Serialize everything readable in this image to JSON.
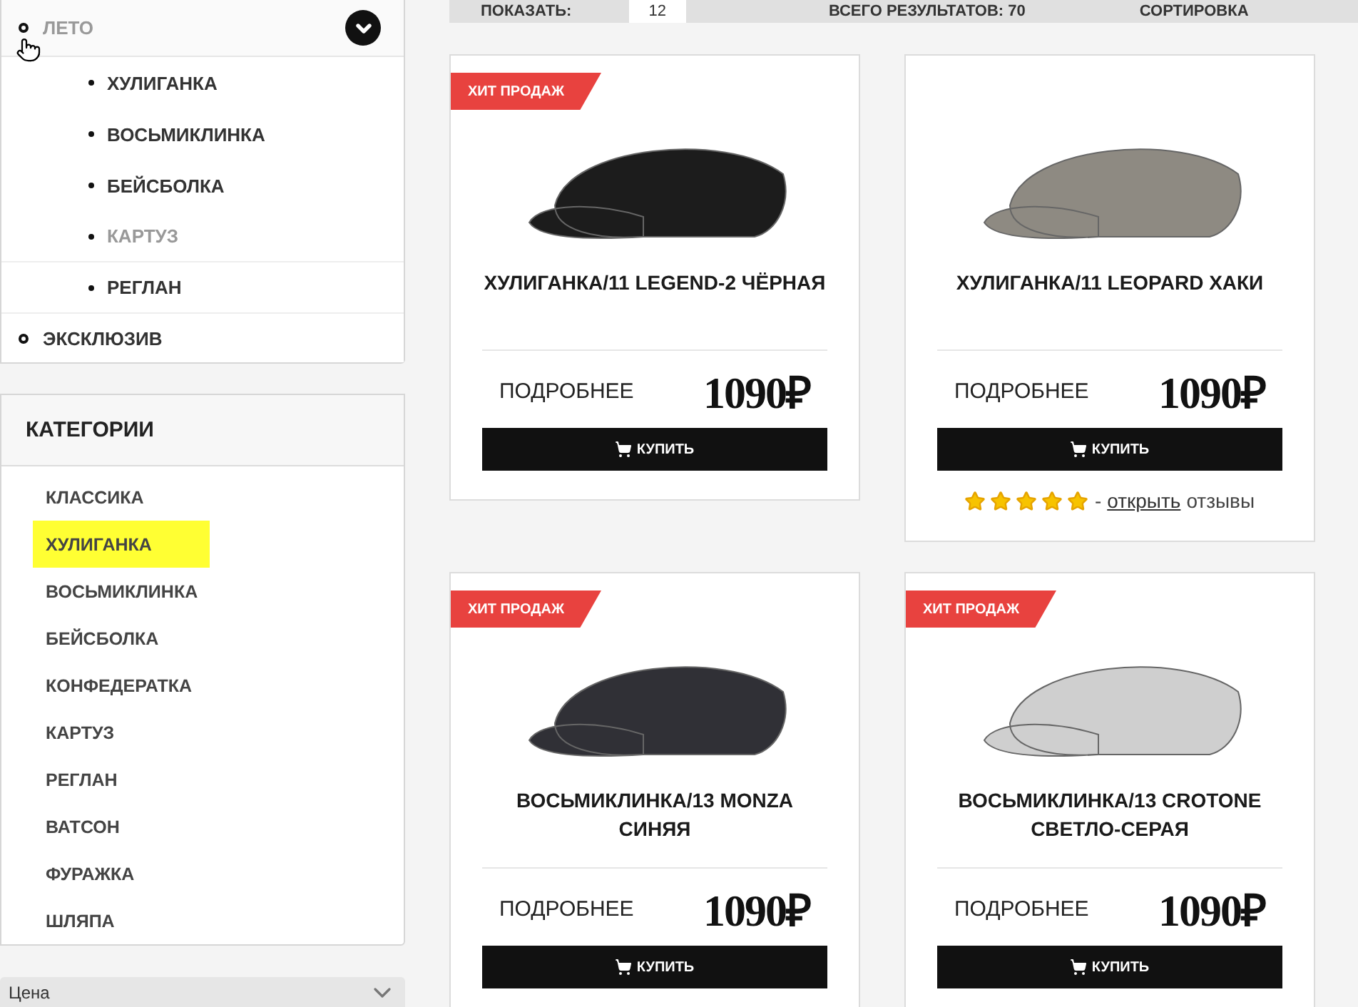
{
  "menu": {
    "items": [
      {
        "label": "ЛЕТО",
        "selected": true,
        "expanded": true,
        "children": [
          {
            "label": "ХУЛИГАНКА",
            "selected": false
          },
          {
            "label": "ВОСЬМИКЛИНКА",
            "selected": false
          },
          {
            "label": "БЕЙСБОЛКА",
            "selected": false
          },
          {
            "label": "КАРТУЗ",
            "selected": true
          },
          {
            "label": "РЕГЛАН",
            "selected": false
          }
        ]
      },
      {
        "label": "ЭКСКЛЮЗИВ",
        "selected": false
      }
    ]
  },
  "categories": {
    "title": "КАТЕГОРИИ",
    "items": [
      {
        "label": "КЛАССИКА",
        "selected": false
      },
      {
        "label": "ХУЛИГАНКА",
        "selected": true
      },
      {
        "label": "ВОСЬМИКЛИНКА",
        "selected": false
      },
      {
        "label": "БЕЙСБОЛКА",
        "selected": false
      },
      {
        "label": "КОНФЕДЕРАТКА",
        "selected": false
      },
      {
        "label": "КАРТУЗ",
        "selected": false
      },
      {
        "label": "РЕГЛАН",
        "selected": false
      },
      {
        "label": "ВАТСОН",
        "selected": false
      },
      {
        "label": "ФУРАЖКА",
        "selected": false
      },
      {
        "label": "ШЛЯПА",
        "selected": false
      }
    ]
  },
  "price_filter": {
    "label": "Цена",
    "expanded": false
  },
  "toolbar": {
    "show_label": "ПОКАЗАТЬ:",
    "show_value": "12",
    "total": "ВСЕГО РЕЗУЛЬТАТОВ: 70",
    "sort_label": "СОРТИРОВКА"
  },
  "products": [
    {
      "badge": "ХИТ ПРОДАЖ",
      "color": "#1c1c1c",
      "title": "ХУЛИГАНКА/11 LEGEND-2 ЧЁРНАЯ",
      "details": "ПОДРОБНЕЕ",
      "price": "1090₽",
      "buy": "КУПИТЬ"
    },
    {
      "color": "#8e8a82",
      "title": "ХУЛИГАНКА/11 LEOPARD ХАКИ",
      "details": "ПОДРОБНЕЕ",
      "price": "1090₽",
      "buy": "КУПИТЬ",
      "reviews": {
        "stars": 5,
        "dash": "-",
        "link": "открыть",
        "text": "отзывы"
      }
    },
    {
      "badge": "ХИТ ПРОДАЖ",
      "color": "#303036",
      "title": "ВОСЬМИКЛИНКА/13 MONZA СИНЯЯ",
      "details": "ПОДРОБНЕЕ",
      "price": "1090₽",
      "buy": "КУПИТЬ"
    },
    {
      "badge": "ХИТ ПРОДАЖ",
      "color": "#cfcfcf",
      "title": "ВОСЬМИКЛИНКА/13 CROTONE СВЕТЛО-СЕРАЯ",
      "details": "ПОДРОБНЕЕ",
      "price": "1090₽",
      "buy": "КУПИТЬ"
    }
  ]
}
